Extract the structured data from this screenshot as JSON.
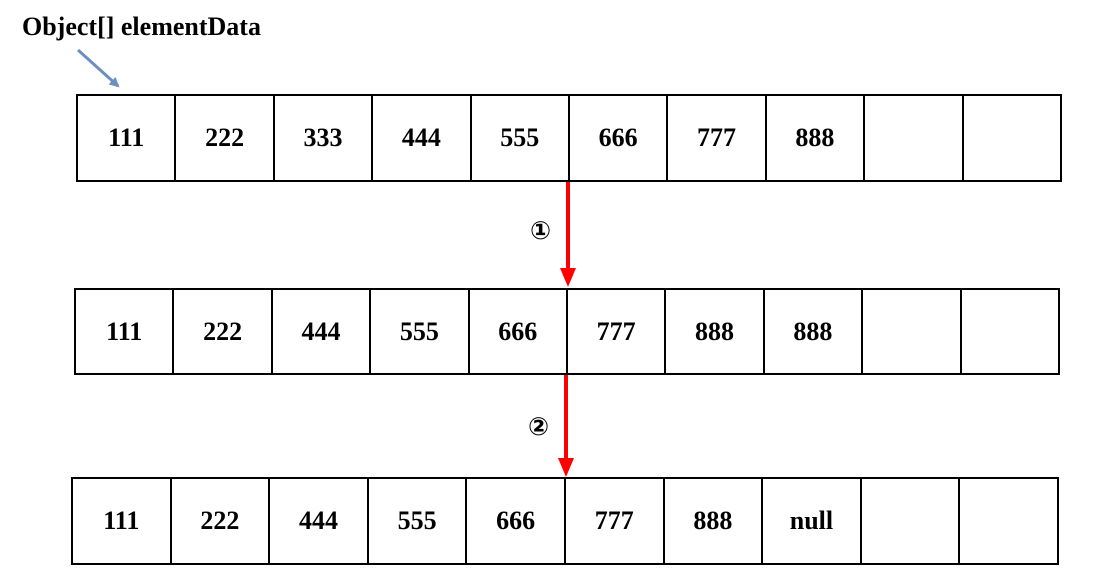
{
  "title": "Object[] elementData",
  "rows": [
    [
      "111",
      "222",
      "333",
      "444",
      "555",
      "666",
      "777",
      "888",
      "",
      ""
    ],
    [
      "111",
      "222",
      "444",
      "555",
      "666",
      "777",
      "888",
      "888",
      "",
      ""
    ],
    [
      "111",
      "222",
      "444",
      "555",
      "666",
      "777",
      "888",
      "null",
      "",
      ""
    ]
  ],
  "steps": [
    "①",
    "②"
  ],
  "colors": {
    "arrow": "#ff0000",
    "pointer": "#6a8fc0"
  }
}
